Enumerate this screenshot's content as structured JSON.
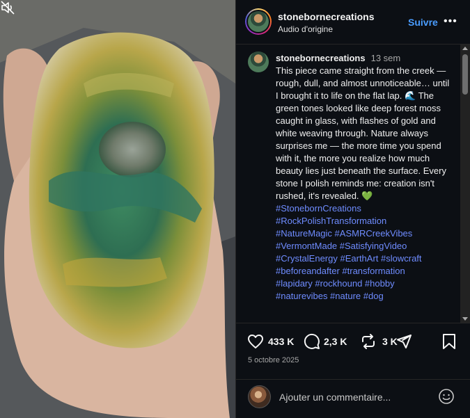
{
  "header": {
    "username": "stonebornecreations",
    "audio": "Audio d'origine",
    "follow": "Suivre",
    "more": "•••"
  },
  "caption": {
    "username": "stonebornecreations",
    "time": "13 sem",
    "text": "This piece came straight from the creek — rough, dull, and almost unnoticeable… until I brought it to life on the flat lap. 🌊 The green tones looked like deep forest moss caught in glass, with flashes of gold and white weaving through. Nature always surprises me — the more time you spend with it, the more you realize how much beauty lies just beneath the surface. Every stone I polish reminds me: creation isn't rushed, it's revealed. 💚",
    "hashtags": [
      "#StonebornCreations",
      "#RockPolishTransformation",
      "#NatureMagic #ASMRCreekVibes",
      "#VermontMade #SatisfyingVideo",
      "#CrystalEnergy #EarthArt #slowcraft",
      "#beforeandafter #transformation",
      "#lapidary #rockhound #hobby",
      "#naturevibes #nature #dog"
    ]
  },
  "actions": {
    "likes": "433 K",
    "comments": "2,3 K",
    "reposts": "3 K"
  },
  "date": "5 octobre 2025",
  "comment_box": {
    "placeholder": "Ajouter un commentaire..."
  },
  "icons": {
    "like": "heart-icon",
    "comment": "comment-icon",
    "repost": "repost-icon",
    "share": "send-icon",
    "save": "bookmark-icon",
    "mute": "muted-speaker-icon",
    "emoji": "emoji-icon"
  },
  "colors": {
    "link": "#4a9dff",
    "hashtag": "#6f8cff",
    "panel_bg": "#0c0f14"
  }
}
